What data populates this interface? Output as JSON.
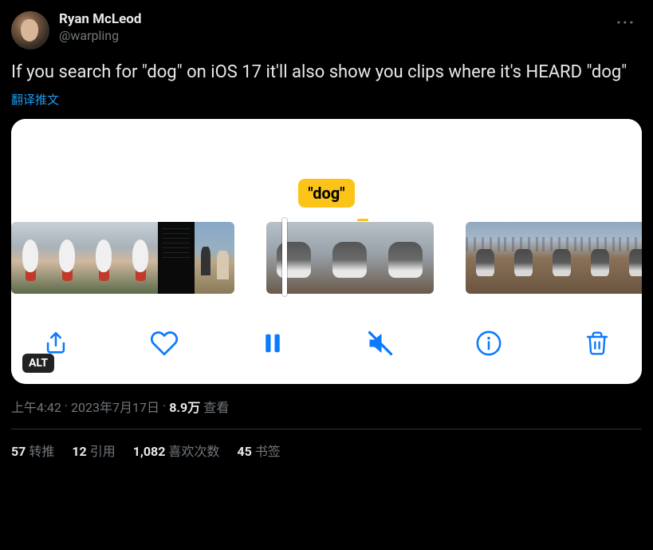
{
  "user": {
    "display_name": "Ryan McLeod",
    "handle": "@warpling"
  },
  "tweet_text": "If you search for \"dog\" on iOS 17 it'll also show you clips where it's HEARD \"dog\"",
  "translate_label": "翻译推文",
  "media": {
    "tooltip": "\"dog\"",
    "alt_badge": "ALT",
    "icons": {
      "share": "share-icon",
      "like": "heart-icon",
      "pause": "pause-icon",
      "mute": "mute-icon",
      "info": "info-icon",
      "trash": "trash-icon"
    }
  },
  "meta": {
    "time": "上午4:42",
    "sep1": " · ",
    "date": "2023年7月17日",
    "sep2": " · ",
    "views_count": "8.9万",
    "views_label": " 查看"
  },
  "stats": {
    "retweets_count": "57",
    "retweets_label": "转推",
    "quotes_count": "12",
    "quotes_label": "引用",
    "likes_count": "1,082",
    "likes_label": "喜欢次数",
    "bookmarks_count": "45",
    "bookmarks_label": "书签"
  }
}
